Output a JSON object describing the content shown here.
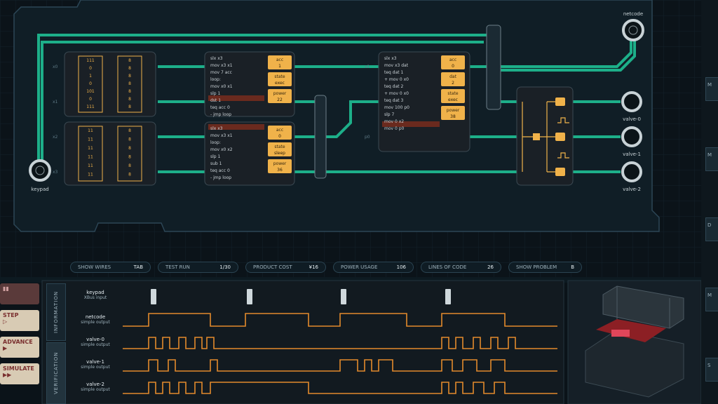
{
  "colors": {
    "wire": "#1fbf94",
    "accent": "#f0b24a",
    "signal": "#e38a2c",
    "background": "#0b1319",
    "panel": "#1a2026"
  },
  "ports": {
    "keypad": "keypad",
    "netcode": "netcode",
    "valve0": "valve-0",
    "valve1": "valve-1",
    "valve2": "valve-2"
  },
  "wire_labels": [
    "x0",
    "x1",
    "x2",
    "x3",
    "p0",
    "x1"
  ],
  "rom_a": {
    "left": [
      "111",
      "0",
      "1",
      "0",
      "101",
      "0",
      "111"
    ],
    "right": [
      "8",
      "8",
      "8",
      "8",
      "8",
      "8",
      "8"
    ]
  },
  "rom_b": {
    "left": [
      "11",
      "11",
      "11",
      "11",
      "11",
      "11"
    ],
    "right": [
      "8",
      "8",
      "8",
      "8",
      "8",
      "8"
    ]
  },
  "mcu1": {
    "code": [
      "slx x3",
      "mov x3 x1",
      "mov 7 acc",
      "loop:",
      "mov x0 x1",
      "slp 1",
      "dst 1",
      "teq acc 0",
      "- jmp loop"
    ],
    "regs": [
      {
        "name": "acc",
        "value": "1"
      },
      {
        "name": "state",
        "value": "exec"
      },
      {
        "name": "power",
        "value": "22"
      }
    ]
  },
  "mcu2": {
    "code": [
      "slx x3",
      "mov x3 x1",
      "loop:",
      "mov x0 x2",
      "slp 1",
      "sub 1",
      "teq acc 0",
      "- jmp loop"
    ],
    "regs": [
      {
        "name": "acc",
        "value": "0"
      },
      {
        "name": "state",
        "value": "sleep"
      },
      {
        "name": "power",
        "value": "36"
      }
    ]
  },
  "mcu3": {
    "code": [
      "slx x3",
      "mov x3 dat",
      "teq dat 1",
      "+ mov 0 x0",
      "teq dat 2",
      "+ mov 0 x0",
      "teq dat 3",
      "mov 100 p0",
      "slp 7",
      "mov 0 x2",
      "mov 0 p0"
    ],
    "regs": [
      {
        "name": "acc",
        "value": "0"
      },
      {
        "name": "dat",
        "value": "2"
      },
      {
        "name": "state",
        "value": "exec"
      },
      {
        "name": "power",
        "value": "38"
      }
    ]
  },
  "stats": [
    {
      "label": "SHOW WIRES",
      "value": "TAB"
    },
    {
      "label": "TEST RUN",
      "value": "1/30"
    },
    {
      "label": "PRODUCT COST",
      "value": "¥16"
    },
    {
      "label": "POWER USAGE",
      "value": "106"
    },
    {
      "label": "LINES OF CODE",
      "value": "26"
    },
    {
      "label": "SHOW PROBLEM",
      "value": "B"
    }
  ],
  "controls": {
    "step": "STEP",
    "advance": "ADVANCE",
    "simulate": "SIMULATE"
  },
  "tabs": {
    "information": "INFORMATION",
    "verification": "VERIFICATION"
  },
  "signals": [
    {
      "name": "keypad",
      "sub": "XBus input"
    },
    {
      "name": "netcode",
      "sub": "simple output"
    },
    {
      "name": "valve-0",
      "sub": "simple output"
    },
    {
      "name": "valve-1",
      "sub": "simple output"
    },
    {
      "name": "valve-2",
      "sub": "simple output"
    }
  ],
  "sidebar": {
    "fragments": [
      "M",
      "M",
      "D",
      "M",
      "S"
    ]
  }
}
